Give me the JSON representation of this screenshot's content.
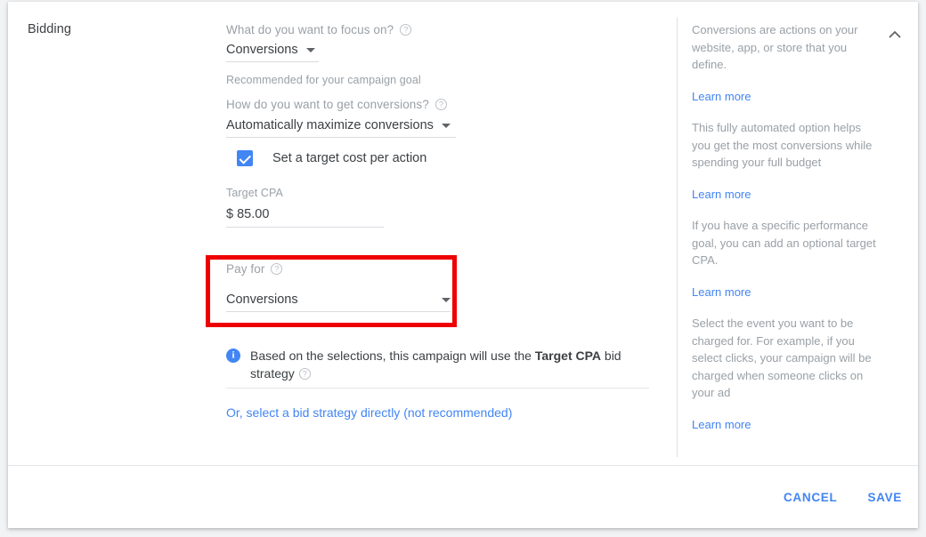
{
  "section": {
    "title": "Bidding"
  },
  "form": {
    "focus": {
      "label": "What do you want to focus on?",
      "value": "Conversions",
      "hint": "Recommended for your campaign goal",
      "help_icon": "help-circle-icon",
      "caret_icon": "chevron-down-icon"
    },
    "how": {
      "label": "How do you want to get conversions?",
      "value": "Automatically maximize conversions",
      "help_icon": "help-circle-icon",
      "caret_icon": "chevron-down-icon"
    },
    "target_cpa_checkbox": {
      "label": "Set a target cost per action",
      "checked": true,
      "icon": "checkbox-checked-icon"
    },
    "target_cpa": {
      "label": "Target CPA",
      "currency": "$",
      "value": "85.00"
    },
    "pay_for": {
      "label": "Pay for",
      "value": "Conversions",
      "help_icon": "help-circle-icon",
      "caret_icon": "chevron-down-icon",
      "highlight_color": "#ee0000"
    },
    "info_note": {
      "icon": "info-circle-icon",
      "text_before": "Based on the selections, this campaign will use the ",
      "strong": "Target CPA",
      "text_after": " bid strategy",
      "help_icon": "help-circle-icon"
    },
    "bid_strategy_link": "Or, select a bid strategy directly (not recommended)"
  },
  "help_panel": {
    "collapse_icon": "chevron-up-icon",
    "blocks": [
      {
        "text": "Conversions are actions on your website, app, or store that you define.",
        "link": "Learn more"
      },
      {
        "text": "This fully automated option helps you get the most conversions while spending your full budget",
        "link": "Learn more"
      },
      {
        "text": "If you have a specific performance goal, you can add an optional target CPA.",
        "link": "Learn more"
      },
      {
        "text": "Select the event you want to be charged for. For example, if you select clicks, your campaign will be charged when someone clicks on your ad",
        "link": "Learn more"
      }
    ]
  },
  "footer": {
    "cancel_label": "CANCEL",
    "save_label": "SAVE"
  },
  "colors": {
    "accent": "#4285f4",
    "highlight": "#ee0000",
    "text": "#3c4043",
    "muted": "#9aa0a6"
  }
}
